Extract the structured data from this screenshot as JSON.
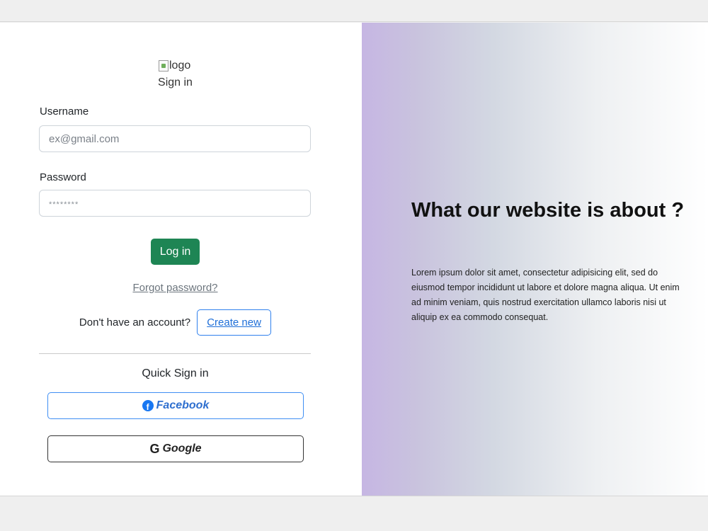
{
  "login": {
    "logo_alt": "logo",
    "title": "Sign in",
    "username_label": "Username",
    "username_placeholder": "ex@gmail.com",
    "password_label": "Password",
    "password_placeholder": "********",
    "login_button": "Log in",
    "forgot_link": "Forgot password?",
    "no_account_text": "Don't have an account?",
    "create_button": "Create new",
    "quick_signin": "Quick Sign in",
    "facebook_button": "Facebook",
    "google_button": "Google",
    "facebook_icon_glyph": "f",
    "google_icon_glyph": "G"
  },
  "about": {
    "title": "What our website is about ?",
    "body": "Lorem ipsum dolor sit amet, consectetur adipisicing elit, sed do eiusmod tempor incididunt ut labore et dolore magna aliqua. Ut enim ad minim veniam, quis nostrud exercitation ullamco laboris nisi ut aliquip ex ea commodo consequat."
  },
  "colors": {
    "primary_green": "#1e8554",
    "link_blue": "#1f6fd8",
    "facebook_blue": "#1877f2",
    "gradient_start": "#c6b6e3",
    "gradient_end": "#ffffff"
  }
}
